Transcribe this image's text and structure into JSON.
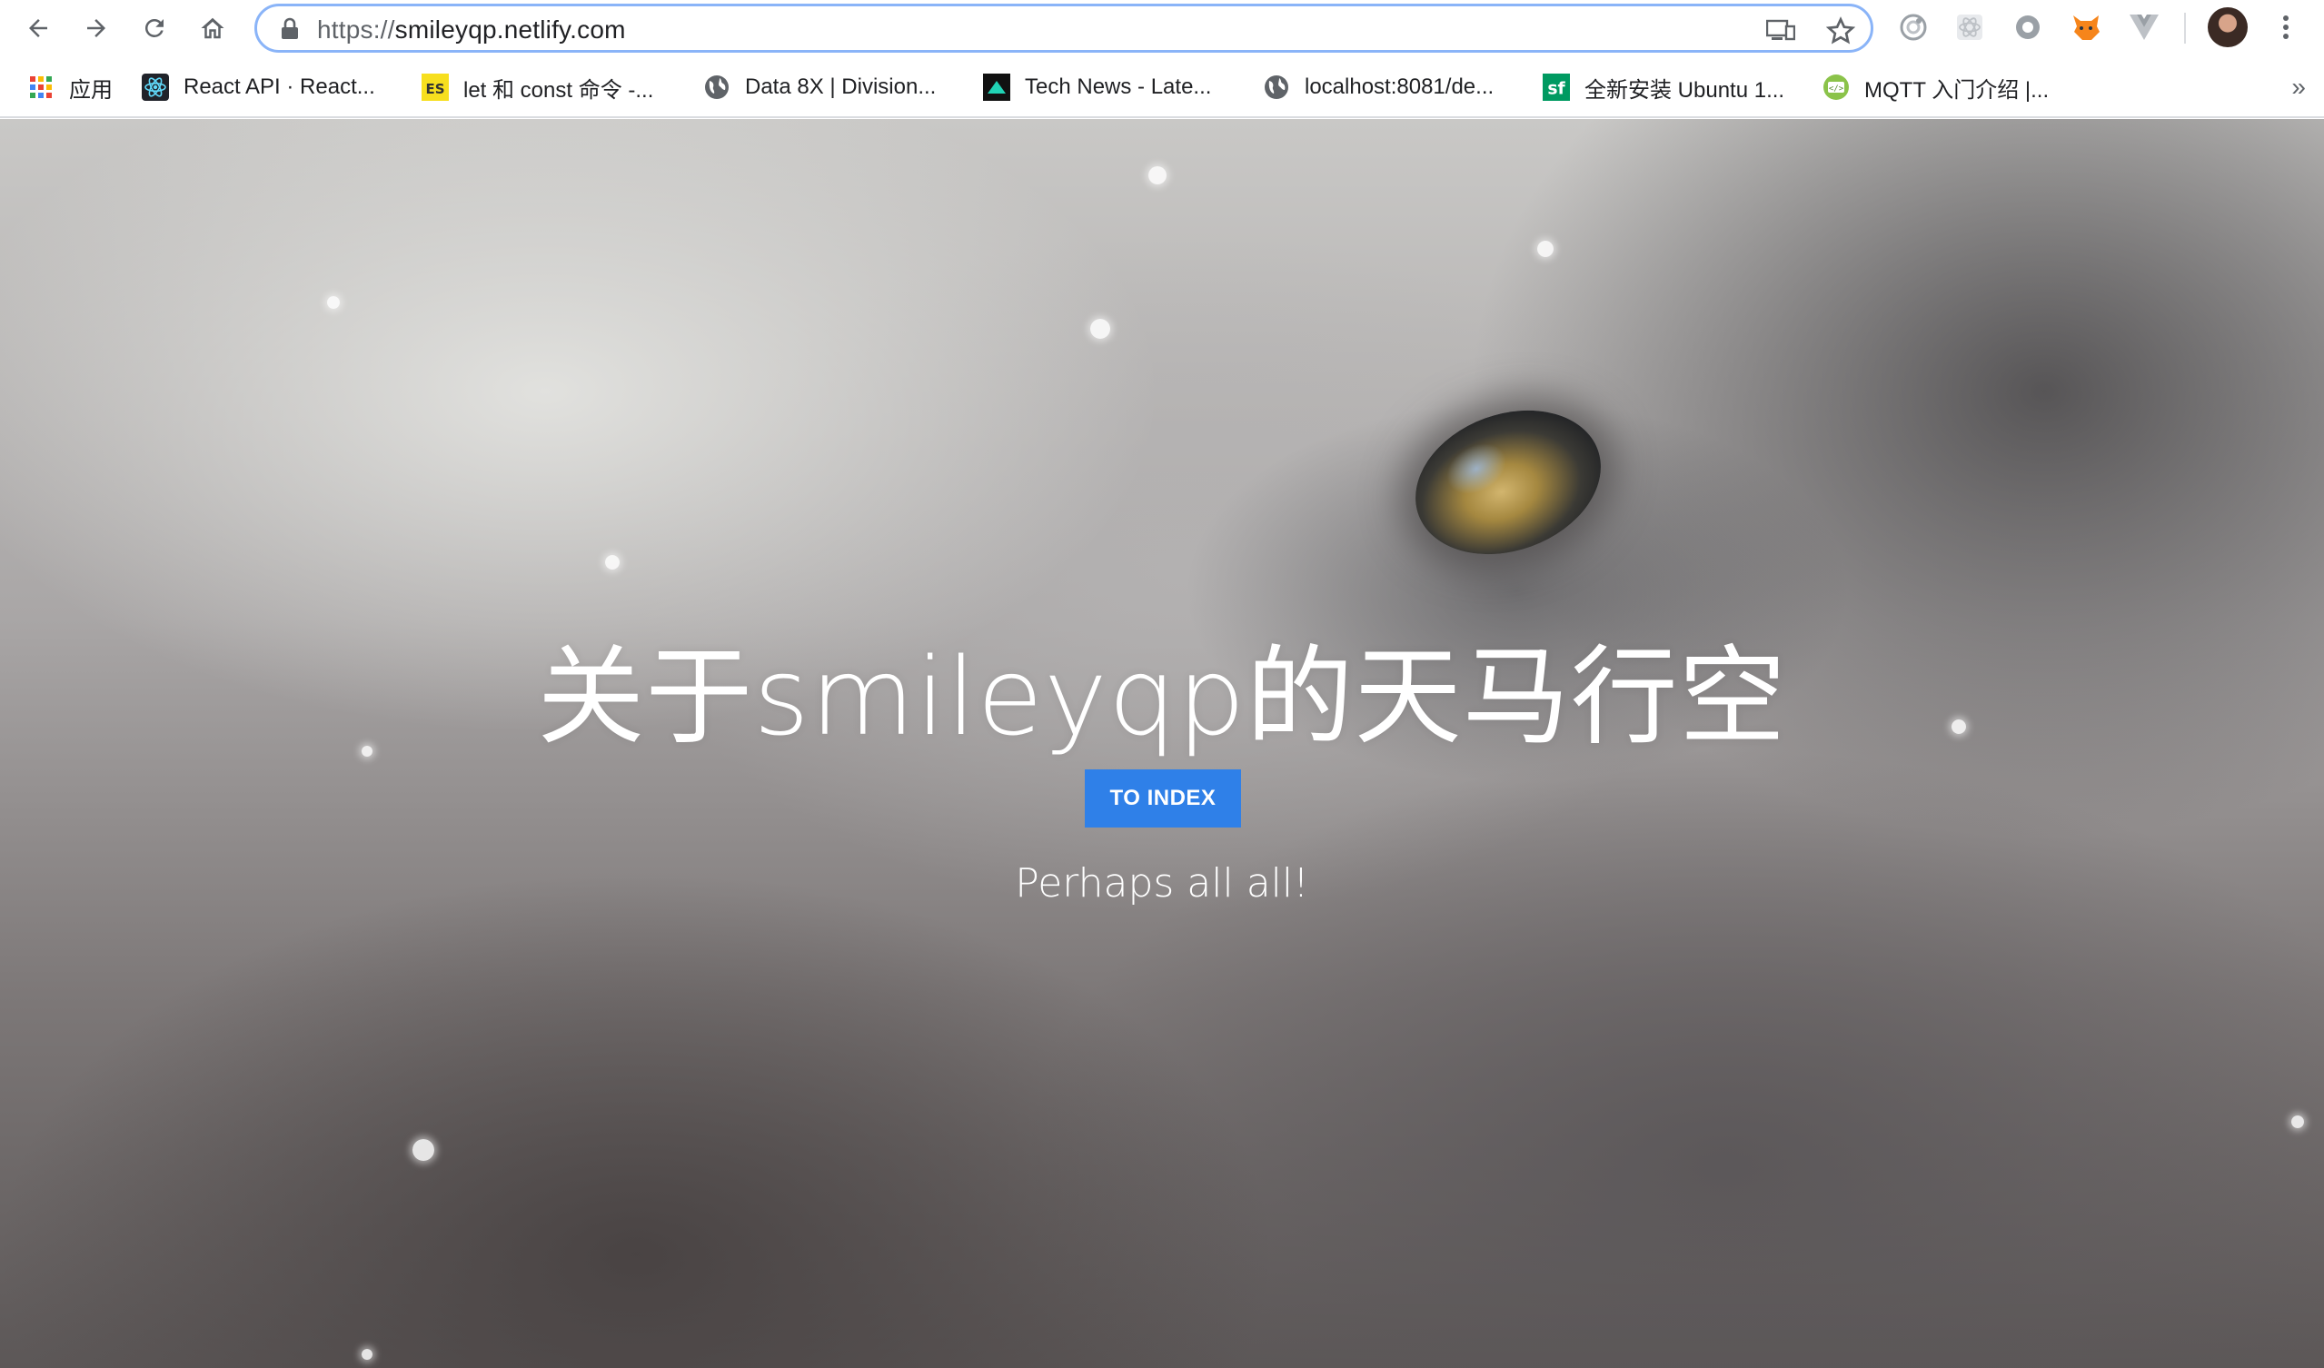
{
  "browser": {
    "url_protocol": "https://",
    "url_host": "smileyqp.netlify.com",
    "accent_focus_color": "#8ab4f8"
  },
  "toolbar": {
    "back_icon": "arrow-left-icon",
    "forward_icon": "arrow-right-icon",
    "reload_icon": "reload-icon",
    "home_icon": "home-icon"
  },
  "bookmarks": [
    {
      "label": "应用",
      "icon": "apps-grid-icon"
    },
    {
      "label": "React API · React...",
      "icon": "react-icon"
    },
    {
      "label": "let 和 const 命令 -...",
      "icon": "es-icon"
    },
    {
      "label": "Data 8X | Division...",
      "icon": "globe-icon"
    },
    {
      "label": "Tech News - Late...",
      "icon": "technews-icon"
    },
    {
      "label": "localhost:8081/de...",
      "icon": "globe-icon"
    },
    {
      "label": "全新安装 Ubuntu 1...",
      "icon": "sf-icon"
    },
    {
      "label": "MQTT 入门介绍 |...",
      "icon": "code-icon"
    }
  ],
  "hero": {
    "title": "关于smileyqp的天马行空",
    "button_label": "TO INDEX",
    "subtitle": "Perhaps all all!",
    "button_color": "#2f80e8"
  }
}
